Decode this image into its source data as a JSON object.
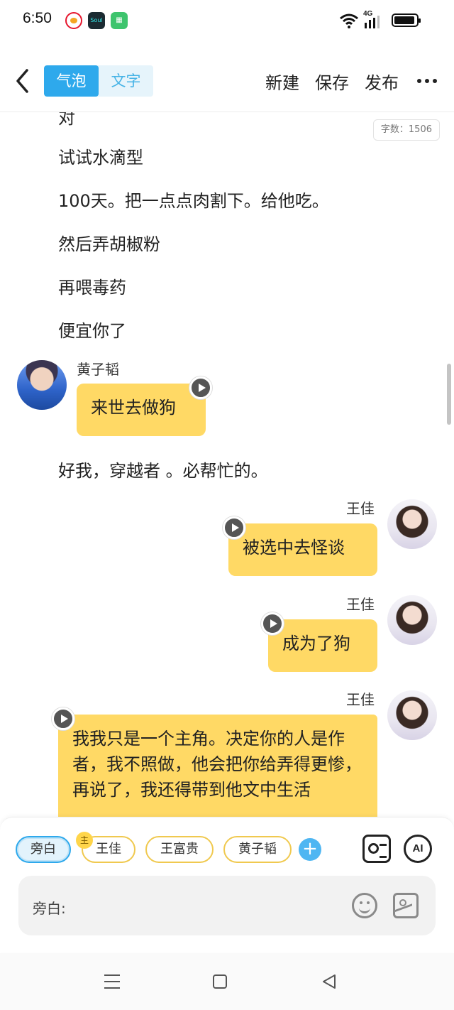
{
  "status": {
    "time": "6:50",
    "network": "4G"
  },
  "header": {
    "mode_bubble": "气泡",
    "mode_text": "文字",
    "new_label": "新建",
    "save_label": "保存",
    "publish_label": "发布"
  },
  "content": {
    "word_count": "字数：1506",
    "partial_line": "对",
    "narration": [
      "试试水滴型",
      "100天。把一点点肉割下。给他吃。",
      "然后弄胡椒粉",
      "再喂毒药",
      "便宜你了"
    ],
    "messages": [
      {
        "speaker": "黄子韬",
        "text": "来世去做狗",
        "side": "left"
      },
      {
        "speaker": "",
        "text": "好我，穿越者 。必帮忙的。",
        "side": "narration"
      },
      {
        "speaker": "王佳",
        "text": "被选中去怪谈",
        "side": "right"
      },
      {
        "speaker": "王佳",
        "text": "成为了狗",
        "side": "right"
      },
      {
        "speaker": "王佳",
        "text": "我我只是一个主角。决定你的人是作者，我不照做，他会把你给弄得更惨，再说了，我还得带到他文中生活",
        "side": "right"
      }
    ]
  },
  "editor": {
    "roles": [
      "旁白",
      "王佳",
      "王富贵",
      "黄子韬"
    ],
    "selected_role": "旁白",
    "main_badge": "主",
    "add_symbol": "+",
    "ai_label": "AI",
    "input_label": "旁白:"
  },
  "colors": {
    "accent": "#2ea9ec",
    "bubble": "#ffd965",
    "chip_border": "#f0c94f"
  }
}
